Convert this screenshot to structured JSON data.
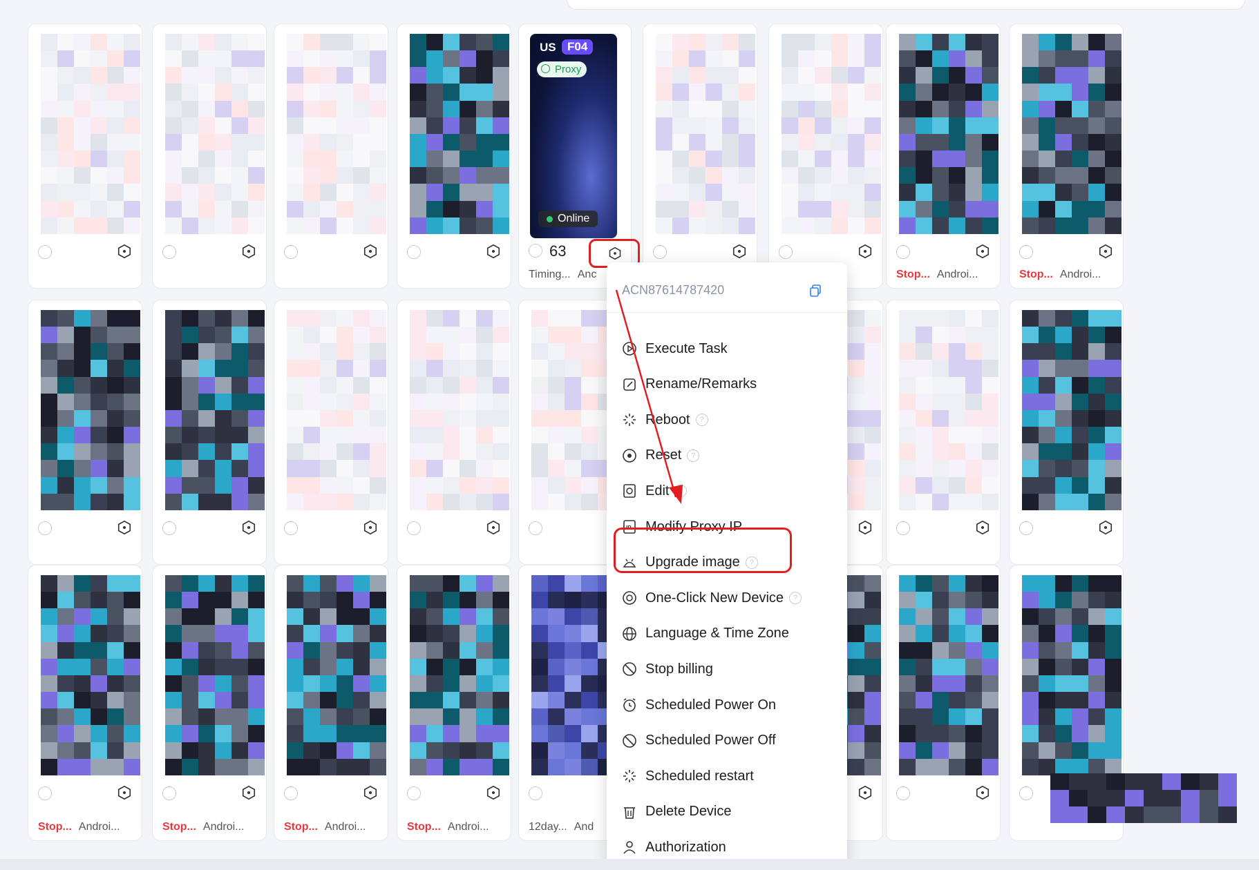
{
  "focus_card": {
    "region": "US",
    "model": "F04",
    "proxy_label": "Proxy",
    "status": "Online",
    "number": "63",
    "footer_left": "Timing...",
    "footer_right": "Anc"
  },
  "menu": {
    "device_id": "ACN87614787420",
    "items": [
      {
        "label": "Execute Task",
        "icon": "play-circle-icon",
        "help": false
      },
      {
        "label": "Rename/Remarks",
        "icon": "edit-icon",
        "help": false
      },
      {
        "label": "Reboot",
        "icon": "loading-spinner-icon",
        "help": true
      },
      {
        "label": "Reset",
        "icon": "reset-circle-icon",
        "help": true
      },
      {
        "label": "Edit",
        "icon": "image-edit-icon",
        "help": true
      },
      {
        "label": "Modify Proxy IP",
        "icon": "ip-icon",
        "help": false
      },
      {
        "label": "Upgrade image",
        "icon": "android-icon",
        "help": true
      },
      {
        "label": "One-Click New Device",
        "icon": "new-device-icon",
        "help": true
      },
      {
        "label": "Language & Time Zone",
        "icon": "globe-icon",
        "help": false
      },
      {
        "label": "Stop billing",
        "icon": "ban-icon",
        "help": false
      },
      {
        "label": "Scheduled Power On",
        "icon": "alarm-clock-icon",
        "help": false
      },
      {
        "label": "Scheduled Power Off",
        "icon": "ban-icon",
        "help": false
      },
      {
        "label": "Scheduled restart",
        "icon": "loading-spinner-icon",
        "help": false
      },
      {
        "label": "Delete Device",
        "icon": "trash-icon",
        "help": false
      },
      {
        "label": "Authorization",
        "icon": "user-icon",
        "help": false
      }
    ]
  },
  "cards_row1": [
    {
      "footer_a": "",
      "footer_b": "",
      "kind": "light"
    },
    {
      "footer_a": "",
      "footer_b": "",
      "kind": "light"
    },
    {
      "footer_a": "",
      "footer_b": "",
      "kind": "light"
    },
    {
      "footer_a": "",
      "footer_b": "",
      "kind": "dark"
    },
    {
      "footer_a": "",
      "footer_b": "",
      "kind": "light"
    },
    {
      "footer_a": "",
      "footer_b": "",
      "kind": "light"
    },
    {
      "footer_a": "Stop...",
      "footer_b": "Androi...",
      "kind": "dark"
    },
    {
      "footer_a": "Stop...",
      "footer_b": "Androi...",
      "kind": "dark"
    },
    {
      "footer_a": "Timing...",
      "footer_b": "And...",
      "kind": "blue"
    }
  ],
  "cards_row3": [
    {
      "footer_a": "Stop...",
      "footer_b": "Androi...",
      "kind": "dark"
    },
    {
      "footer_a": "Stop...",
      "footer_b": "Androi...",
      "kind": "dark"
    },
    {
      "footer_a": "Stop...",
      "footer_b": "Androi...",
      "kind": "dark"
    },
    {
      "footer_a": "Stop...",
      "footer_b": "Androi...",
      "kind": "dark"
    },
    {
      "footer_a": "12day...",
      "footer_b": "And",
      "kind": "blue"
    }
  ],
  "colors": {
    "accent": "#e02020",
    "online": "#2ecc71",
    "model_badge": "#6a4cff"
  }
}
